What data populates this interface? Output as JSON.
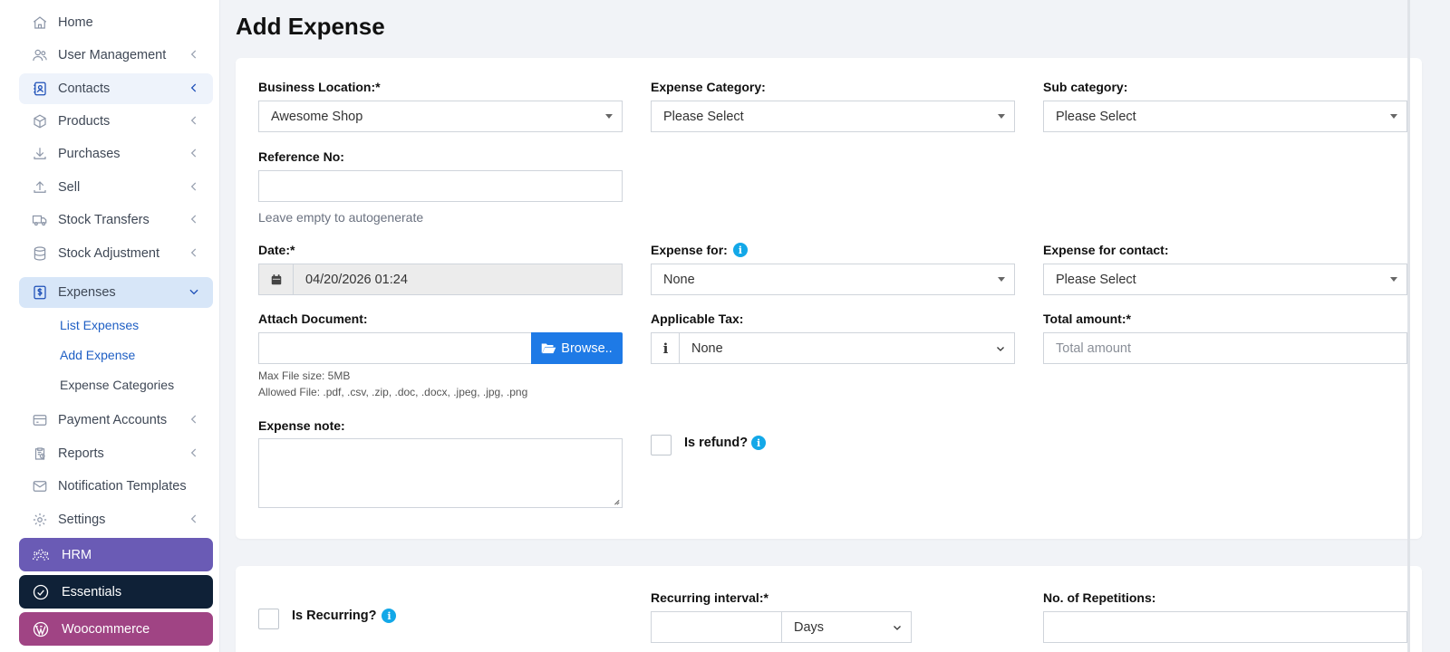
{
  "sidebar": {
    "items": [
      {
        "label": "Home",
        "icon": "home-icon"
      },
      {
        "label": "User Management",
        "icon": "users-icon"
      },
      {
        "label": "Contacts",
        "icon": "contact-book-icon"
      },
      {
        "label": "Products",
        "icon": "cube-icon"
      },
      {
        "label": "Purchases",
        "icon": "download-icon"
      },
      {
        "label": "Sell",
        "icon": "upload-icon"
      },
      {
        "label": "Stock Transfers",
        "icon": "truck-icon"
      },
      {
        "label": "Stock Adjustment",
        "icon": "database-icon"
      },
      {
        "label": "Expenses",
        "icon": "dollar-receipt-icon"
      },
      {
        "label": "Payment Accounts",
        "icon": "credit-card-icon"
      },
      {
        "label": "Reports",
        "icon": "report-clipboard-icon"
      },
      {
        "label": "Notification Templates",
        "icon": "envelope-icon"
      },
      {
        "label": "Settings",
        "icon": "gear-icon"
      }
    ],
    "expenses_sub": [
      "List Expenses",
      "Add Expense",
      "Expense Categories"
    ],
    "extensions": [
      {
        "label": "HRM",
        "color": "#6a5bb5"
      },
      {
        "label": "Essentials",
        "color": "#0f2137"
      },
      {
        "label": "Woocommerce",
        "color": "#a04484"
      }
    ]
  },
  "page": {
    "title": "Add Expense"
  },
  "form": {
    "business_location": {
      "label": "Business Location:*",
      "value": "Awesome Shop"
    },
    "expense_category": {
      "label": "Expense Category:",
      "value": "Please Select"
    },
    "sub_category": {
      "label": "Sub category:",
      "value": "Please Select"
    },
    "reference_no": {
      "label": "Reference No:",
      "value": "",
      "help": "Leave empty to autogenerate"
    },
    "date": {
      "label": "Date:*",
      "value": "04/20/2026 01:24"
    },
    "expense_for": {
      "label": "Expense for:",
      "value": "None"
    },
    "expense_for_contact": {
      "label": "Expense for contact:",
      "value": "Please Select"
    },
    "attach_document": {
      "label": "Attach Document:",
      "browse": "Browse..",
      "help_size": "Max File size: 5MB",
      "help_types": "Allowed File: .pdf, .csv, .zip, .doc, .docx, .jpeg, .jpg, .png"
    },
    "applicable_tax": {
      "label": "Applicable Tax:",
      "value": "None"
    },
    "total_amount": {
      "label": "Total amount:*",
      "placeholder": "Total amount"
    },
    "expense_note": {
      "label": "Expense note:"
    },
    "is_refund": {
      "label": "Is refund?"
    }
  },
  "recurring": {
    "is_recurring": {
      "label": "Is Recurring?"
    },
    "interval": {
      "label": "Recurring interval:*",
      "unit": "Days"
    },
    "repetitions": {
      "label": "No. of Repetitions:"
    }
  },
  "colors": {
    "accent": "#1e7ae6",
    "info": "#13a8e8",
    "active_nav": "#d7e6f8"
  }
}
